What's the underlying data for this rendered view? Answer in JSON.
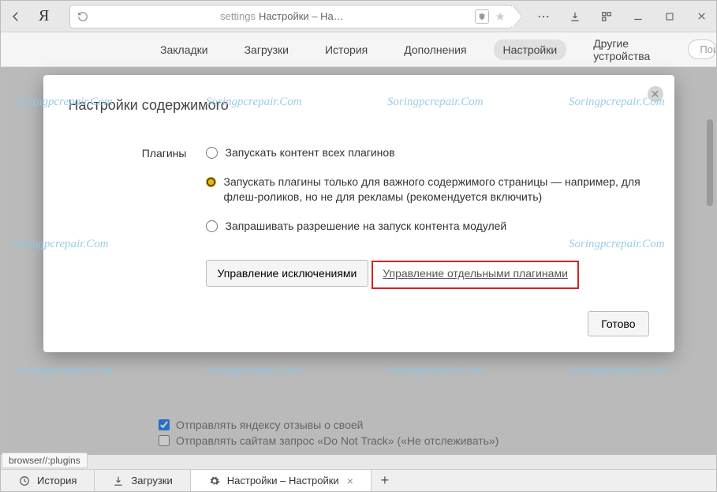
{
  "chrome": {
    "logo": "Я",
    "address_prefix": "settings",
    "address_title": "Настройки – На…"
  },
  "nav": {
    "tabs": [
      "Закладки",
      "Загрузки",
      "История",
      "Дополнения",
      "Настройки",
      "Другие устройства"
    ],
    "active_index": 4,
    "search_placeholder": "Поиск наст"
  },
  "dialog": {
    "title": "Настройки содержимого",
    "section_label": "Плагины",
    "options": [
      "Запускать контент всех плагинов",
      "Запускать плагины только для важного содержимого страницы — например, для флеш-роликов, но не для рекламы (рекомендуется включить)",
      "Запрашивать разрешение на запуск контента модулей"
    ],
    "selected_index": 1,
    "exceptions_btn": "Управление исключениями",
    "manage_link": "Управление отдельными плагинами",
    "done_btn": "Готово"
  },
  "bg_rows": {
    "row1": "Отправлять яндексу отзывы о своей",
    "row2": "Отправлять сайтам запрос «Do Not Track» («Не отслеживать»)"
  },
  "status_url": "browser//:plugins",
  "bottom_tabs": {
    "history": "История",
    "downloads": "Загрузки",
    "settings": "Настройки – Настройки"
  },
  "watermark": "Soringpcrepair.Com"
}
